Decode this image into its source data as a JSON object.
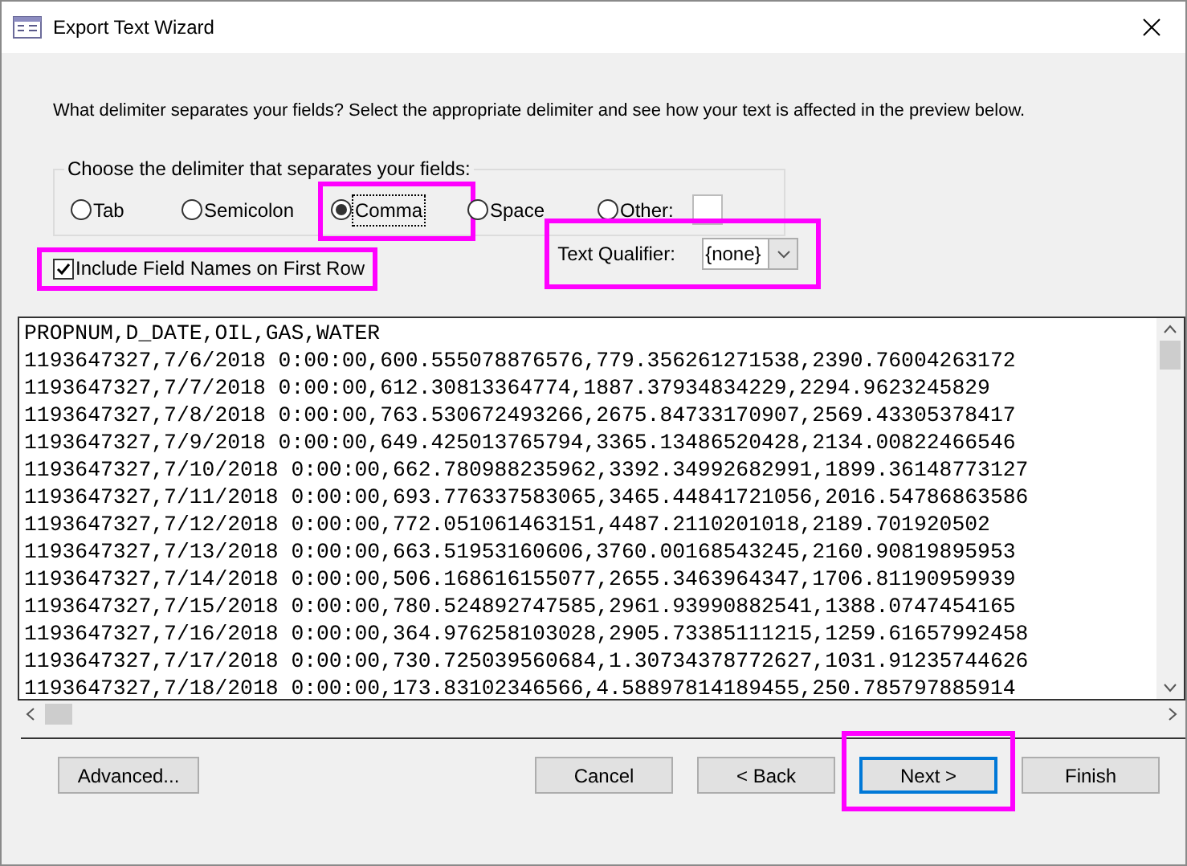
{
  "window": {
    "title": "Export Text Wizard"
  },
  "instruction": "What delimiter separates your fields? Select the appropriate delimiter and see how your text is affected in the preview below.",
  "delimiter_group": {
    "legend": "Choose the delimiter that separates your fields:",
    "options": [
      {
        "label": "Tab",
        "selected": false,
        "highlighted": false
      },
      {
        "label": "Semicolon",
        "selected": false,
        "highlighted": false
      },
      {
        "label": "Comma",
        "selected": true,
        "highlighted": true
      },
      {
        "label": "Space",
        "selected": false,
        "highlighted": false
      },
      {
        "label": "Other:",
        "selected": false,
        "highlighted": false
      }
    ]
  },
  "include_field_names": {
    "label": "Include Field Names on First Row",
    "checked": true,
    "highlighted": true
  },
  "text_qualifier": {
    "label": "Text Qualifier:",
    "value": "{none}",
    "highlighted": true
  },
  "preview_lines": [
    "PROPNUM,D_DATE,OIL,GAS,WATER",
    "1193647327,7/6/2018 0:00:00,600.555078876576,779.356261271538,2390.76004263172",
    "1193647327,7/7/2018 0:00:00,612.30813364774,1887.37934834229,2294.9623245829",
    "1193647327,7/8/2018 0:00:00,763.530672493266,2675.84733170907,2569.43305378417",
    "1193647327,7/9/2018 0:00:00,649.425013765794,3365.13486520428,2134.00822466546",
    "1193647327,7/10/2018 0:00:00,662.780988235962,3392.34992682991,1899.36148773127",
    "1193647327,7/11/2018 0:00:00,693.776337583065,3465.44841721056,2016.54786863586",
    "1193647327,7/12/2018 0:00:00,772.051061463151,4487.2110201018,2189.701920502",
    "1193647327,7/13/2018 0:00:00,663.51953160606,3760.00168543245,2160.90819895953",
    "1193647327,7/14/2018 0:00:00,506.168616155077,2655.3463964347,1706.81190959939",
    "1193647327,7/15/2018 0:00:00,780.524892747585,2961.93990882541,1388.0747454165",
    "1193647327,7/16/2018 0:00:00,364.976258103028,2905.73385111215,1259.61657992458",
    "1193647327,7/17/2018 0:00:00,730.725039560684,1.30734378772627,1031.91235744626",
    "1193647327,7/18/2018 0:00:00,173.83102346566,4.58897814189455,250.785797885914"
  ],
  "buttons": [
    {
      "label": "Advanced...",
      "kind": "left",
      "focused": false,
      "highlighted": false
    },
    {
      "label": "Cancel",
      "kind": "right",
      "focused": false,
      "highlighted": false
    },
    {
      "label": "< Back",
      "kind": "right",
      "focused": false,
      "highlighted": false
    },
    {
      "label": "Next >",
      "kind": "right",
      "focused": true,
      "highlighted": true
    },
    {
      "label": "Finish",
      "kind": "right",
      "focused": false,
      "highlighted": false
    }
  ]
}
